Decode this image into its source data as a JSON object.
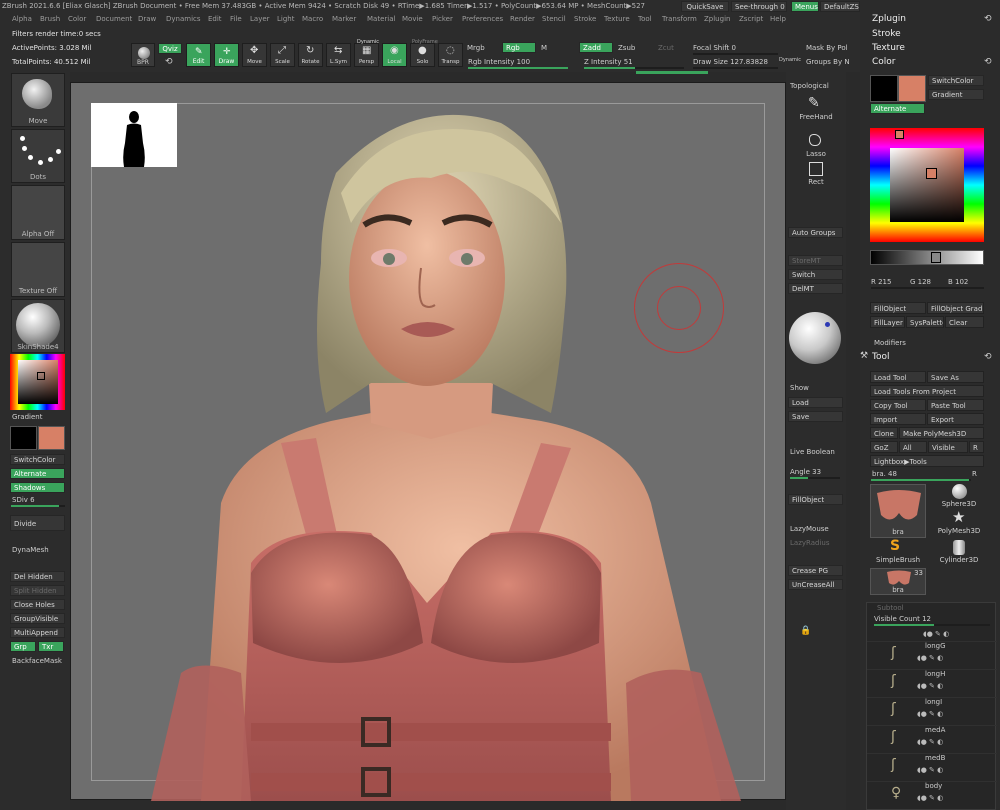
{
  "menu": {
    "title_line": "ZBrush 2021.6.6 [Eliax Glasch]   ZBrush Document    • Free Mem 37.483GB • Active Mem 9424 • Scratch Disk 49 •  RTime▶1.685 Timer▶1.517 • PolyCount▶653.64 MP • MeshCount▶527",
    "quicksave": "QuickSave",
    "see_through": "See-through  0",
    "menus_btn": "Menus",
    "default_script": "DefaultZScript",
    "items": [
      "Alpha",
      "Brush",
      "Color",
      "Document",
      "Draw",
      "Dynamics",
      "Edit",
      "File",
      "Layer",
      "Light",
      "Macro",
      "Marker",
      "Material",
      "Movie",
      "Picker",
      "Preferences",
      "Render",
      "Stencil",
      "Stroke",
      "Texture",
      "Tool",
      "Transform",
      "Zplugin",
      "Zscript",
      "Help"
    ]
  },
  "info": {
    "filters": "Filters render time:0 secs",
    "active_points": "ActivePoints: 3.028 Mil",
    "total_points": "TotalPoints: 40.512 Mil"
  },
  "toolbar": {
    "bpr": "BPR",
    "qviz": "Qviz",
    "edit": "Edit",
    "draw": "Draw",
    "move": "Move",
    "scale": "Scale",
    "rotate": "Rotate",
    "lsym": "L.Sym",
    "persp": "Persp",
    "local": "Local",
    "solo": "Solo",
    "transp": "Transp",
    "dynamic": "Dynamic",
    "polyframe": "PolyFrame",
    "mrgb": "Mrgb",
    "rgb": "Rgb",
    "m": "M",
    "zadd": "Zadd",
    "zsub": "Zsub",
    "zcut": "Zcut",
    "rgb_intensity": "Rgb Intensity 100",
    "z_intensity": "Z Intensity 51",
    "focal_shift": "Focal Shift 0",
    "draw_size": "Draw Size 127.83828",
    "dynamic2": "Dynamic",
    "mask_by_pol": "Mask By Pol",
    "groups_by": "Groups By N",
    "rgb_intensity_level": 1.0,
    "z_intensity_level": 0.51
  },
  "left": {
    "move": "Move",
    "dots": "Dots",
    "alpha_off": "Alpha Off",
    "texture_off": "Texture Off",
    "skinshade": "SkinShade4",
    "gradient": "Gradient",
    "switchcolor": "SwitchColor",
    "alternate": "Alternate",
    "shadows": "Shadows",
    "sdiv": "SDiv 6",
    "divide": "Divide",
    "dynamesh": "DynaMesh",
    "del_hidden": "Del Hidden",
    "split_hidden": "Split Hidden",
    "close_holes": "Close Holes",
    "group_visible": "GroupVisible",
    "multiappend": "MultiAppend",
    "grp": "Grp",
    "txr": "Txr",
    "backfacemask": "BackfaceMask"
  },
  "shelf": {
    "topological": "Topological",
    "freehand": "FreeHand",
    "lasso": "Lasso",
    "rect": "Rect",
    "auto_groups": "Auto Groups",
    "storemt": "StoreMT",
    "switch": "Switch",
    "delmt": "DelMT",
    "show": "Show",
    "load": "Load",
    "save": "Save",
    "live_boolean": "Live Boolean",
    "angle": "Angle 33",
    "fillobject": "FillObject",
    "lazymouse": "LazyMouse",
    "lazyradius": "LazyRadius",
    "crease_pg": "Crease PG",
    "uncreaseall": "UnCreaseAll"
  },
  "tray": {
    "zplugin": "Zplugin",
    "stroke": "Stroke",
    "texture": "Texture",
    "color": "Color",
    "switchcolor": "SwitchColor",
    "gradient": "Gradient",
    "alternate": "Alternate",
    "r": "R 215",
    "g": "G 128",
    "b": "B 102",
    "fillobject": "FillObject",
    "fillobject_grad": "FillObject Grad",
    "filllayer": "FillLayer",
    "syspalette": "SysPalette",
    "clear": "Clear",
    "modifiers": "Modifiers",
    "tool": "Tool",
    "load_tool": "Load Tool",
    "save_as": "Save As",
    "load_tools_project": "Load Tools From Project",
    "copy_tool": "Copy Tool",
    "paste_tool": "Paste Tool",
    "import": "Import",
    "export": "Export",
    "clone": "Clone",
    "make_polymesh": "Make PolyMesh3D",
    "goz": "GoZ",
    "all": "All",
    "visible": "Visible",
    "r_btn": "R",
    "lightbox_tools": "Lightbox▶Tools",
    "bra_slider": "bra. 48",
    "r2": "R",
    "thumb_bra": "bra",
    "thumb_sphere": "Sphere3D",
    "thumb_polymesh": "PolyMesh3D",
    "thumb_simplebrush": "SimpleBrush",
    "thumb_cylinder": "Cylinder3D",
    "thumb_bra2": "bra",
    "thumb_count": "33",
    "subtool": "Subtool",
    "visible_count": "Visible Count 12",
    "subtools": [
      "longG",
      "longH",
      "longI",
      "medA",
      "medB",
      "body"
    ]
  },
  "colors": {
    "accent": "#3aa45c",
    "main_color": "#000000",
    "secondary_color": "#d78066",
    "canvas_bg": "#6e6e6e"
  }
}
